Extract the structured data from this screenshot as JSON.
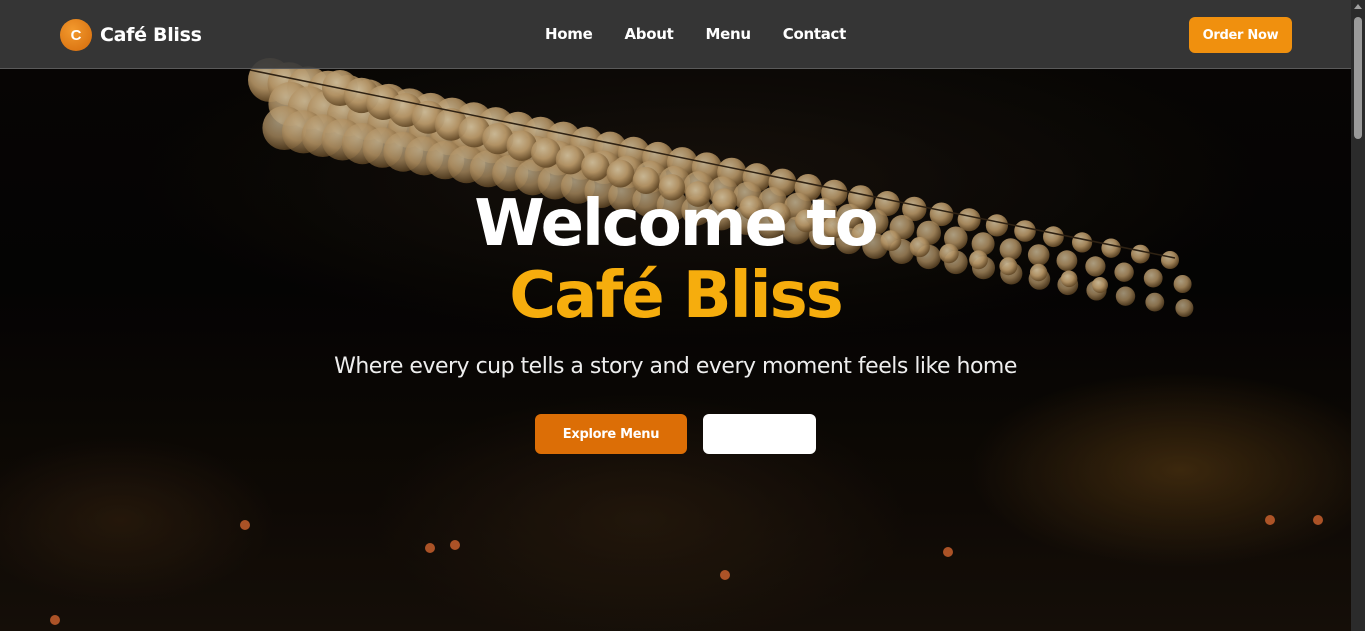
{
  "brand": {
    "logo_letter": "C",
    "name": "Café Bliss"
  },
  "nav": {
    "links": [
      "Home",
      "About",
      "Menu",
      "Contact"
    ],
    "cta_label": "Order Now"
  },
  "hero": {
    "title_line1": "Welcome to",
    "title_line2": "Café Bliss",
    "tagline": "Where every cup tells a story and every moment feels like home",
    "primary_button": "Explore Menu",
    "secondary_button": ""
  },
  "colors": {
    "accent": "#f0900e",
    "title_highlight": "#f6ad0d",
    "nav_bg": "#3a3a3a"
  },
  "icons": {
    "logo": "logo-c-icon",
    "scroll_up": "scroll-up-icon"
  }
}
